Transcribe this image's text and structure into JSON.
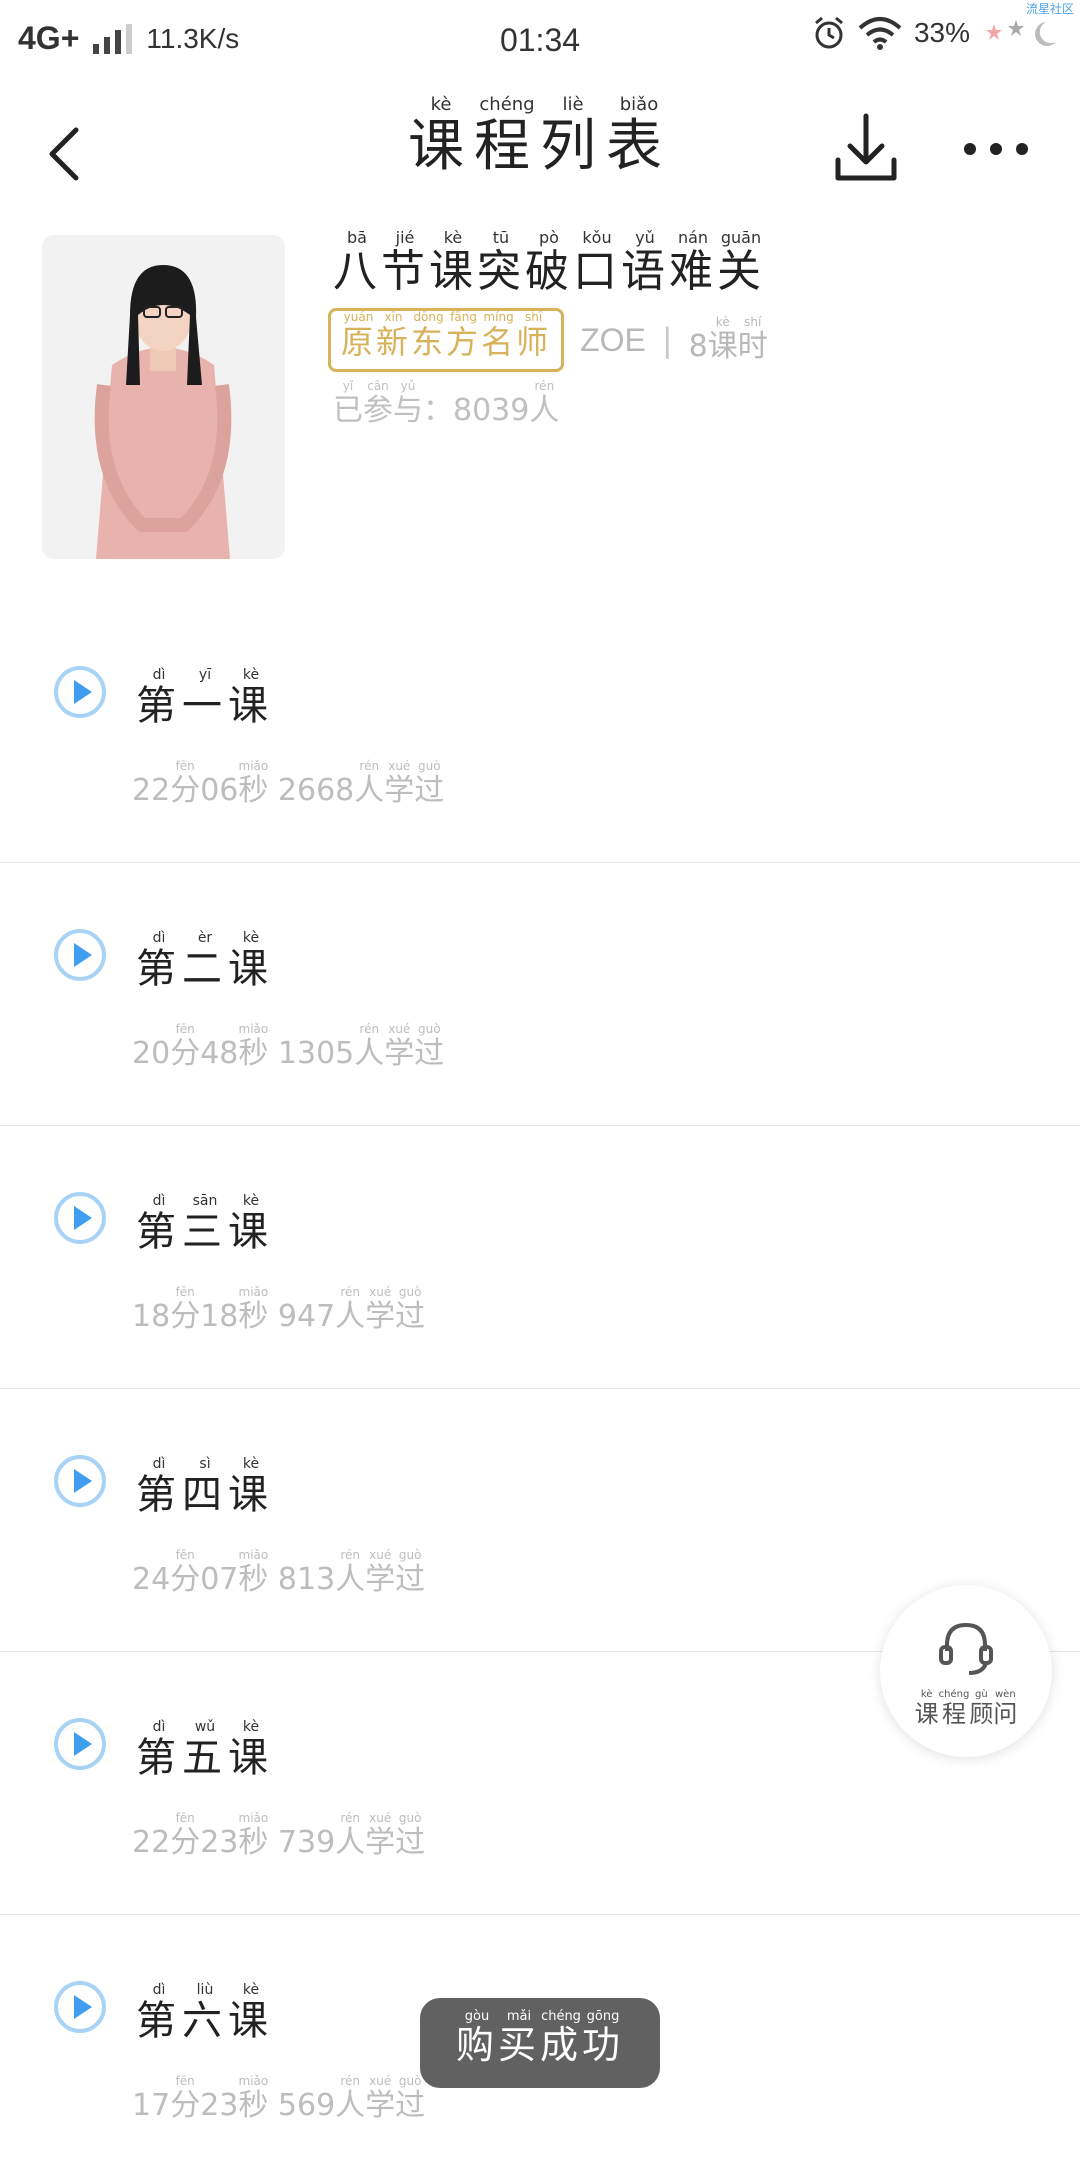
{
  "status_bar": {
    "network": "4G+",
    "speed": "11.3K/s",
    "time": "01:34",
    "battery": "33%",
    "brand_tag": "流星社区",
    "icons": [
      "signal-icon",
      "alarm-icon",
      "wifi-icon",
      "stars-moon-icon"
    ]
  },
  "nav": {
    "title": [
      {
        "c": "课",
        "p": "kè"
      },
      {
        "c": "程",
        "p": "chéng"
      },
      {
        "c": "列",
        "p": "liè"
      },
      {
        "c": "表",
        "p": "biǎo"
      }
    ],
    "icons": {
      "back": "back-chevron-icon",
      "download": "download-icon",
      "more": "more-dots-icon"
    }
  },
  "course": {
    "title": [
      {
        "c": "八",
        "p": "bā"
      },
      {
        "c": "节",
        "p": "jié"
      },
      {
        "c": "课",
        "p": "kè"
      },
      {
        "c": "突",
        "p": "tū"
      },
      {
        "c": "破",
        "p": "pò"
      },
      {
        "c": "口",
        "p": "kǒu"
      },
      {
        "c": "语",
        "p": "yǔ"
      },
      {
        "c": "难",
        "p": "nán"
      },
      {
        "c": "关",
        "p": "guān"
      }
    ],
    "teacher_badge": [
      {
        "c": "原",
        "p": "yuán"
      },
      {
        "c": "新",
        "p": "xīn"
      },
      {
        "c": "东",
        "p": "dōng"
      },
      {
        "c": "方",
        "p": "fāng"
      },
      {
        "c": "名",
        "p": "míng"
      },
      {
        "c": "师",
        "p": "shī"
      }
    ],
    "teacher_name": "ZOE",
    "separator": "|",
    "lesson_count": [
      {
        "c": "8",
        "p": ""
      },
      {
        "c": "课",
        "p": "kè"
      },
      {
        "c": "时",
        "p": "shí"
      }
    ],
    "participants": [
      {
        "c": "已",
        "p": "yǐ"
      },
      {
        "c": "参",
        "p": "cān"
      },
      {
        "c": "与",
        "p": "yǔ"
      },
      {
        "c": "：",
        "p": ""
      },
      {
        "c": "8039",
        "p": ""
      },
      {
        "c": "人",
        "p": "rén"
      }
    ]
  },
  "lessons": [
    {
      "title": [
        {
          "c": "第",
          "p": "dì"
        },
        {
          "c": "一",
          "p": "yī"
        },
        {
          "c": "课",
          "p": "kè"
        }
      ],
      "stats": [
        {
          "c": "22",
          "p": ""
        },
        {
          "c": "分",
          "p": "fēn"
        },
        {
          "c": "06",
          "p": ""
        },
        {
          "c": "秒",
          "p": "miǎo"
        },
        {
          "c": " 2668",
          "p": ""
        },
        {
          "c": "人",
          "p": "rén"
        },
        {
          "c": "学",
          "p": "xué"
        },
        {
          "c": "过",
          "p": "guò"
        }
      ]
    },
    {
      "title": [
        {
          "c": "第",
          "p": "dì"
        },
        {
          "c": "二",
          "p": "èr"
        },
        {
          "c": "课",
          "p": "kè"
        }
      ],
      "stats": [
        {
          "c": "20",
          "p": ""
        },
        {
          "c": "分",
          "p": "fēn"
        },
        {
          "c": "48",
          "p": ""
        },
        {
          "c": "秒",
          "p": "miǎo"
        },
        {
          "c": " 1305",
          "p": ""
        },
        {
          "c": "人",
          "p": "rén"
        },
        {
          "c": "学",
          "p": "xué"
        },
        {
          "c": "过",
          "p": "guò"
        }
      ]
    },
    {
      "title": [
        {
          "c": "第",
          "p": "dì"
        },
        {
          "c": "三",
          "p": "sān"
        },
        {
          "c": "课",
          "p": "kè"
        }
      ],
      "stats": [
        {
          "c": "18",
          "p": ""
        },
        {
          "c": "分",
          "p": "fēn"
        },
        {
          "c": "18",
          "p": ""
        },
        {
          "c": "秒",
          "p": "miǎo"
        },
        {
          "c": " 947",
          "p": ""
        },
        {
          "c": "人",
          "p": "rén"
        },
        {
          "c": "学",
          "p": "xué"
        },
        {
          "c": "过",
          "p": "guò"
        }
      ]
    },
    {
      "title": [
        {
          "c": "第",
          "p": "dì"
        },
        {
          "c": "四",
          "p": "sì"
        },
        {
          "c": "课",
          "p": "kè"
        }
      ],
      "stats": [
        {
          "c": "24",
          "p": ""
        },
        {
          "c": "分",
          "p": "fēn"
        },
        {
          "c": "07",
          "p": ""
        },
        {
          "c": "秒",
          "p": "miǎo"
        },
        {
          "c": " 813",
          "p": ""
        },
        {
          "c": "人",
          "p": "rén"
        },
        {
          "c": "学",
          "p": "xué"
        },
        {
          "c": "过",
          "p": "guò"
        }
      ]
    },
    {
      "title": [
        {
          "c": "第",
          "p": "dì"
        },
        {
          "c": "五",
          "p": "wǔ"
        },
        {
          "c": "课",
          "p": "kè"
        }
      ],
      "stats": [
        {
          "c": "22",
          "p": ""
        },
        {
          "c": "分",
          "p": "fēn"
        },
        {
          "c": "23",
          "p": ""
        },
        {
          "c": "秒",
          "p": "miǎo"
        },
        {
          "c": " 739",
          "p": ""
        },
        {
          "c": "人",
          "p": "rén"
        },
        {
          "c": "学",
          "p": "xué"
        },
        {
          "c": "过",
          "p": "guò"
        }
      ]
    },
    {
      "title": [
        {
          "c": "第",
          "p": "dì"
        },
        {
          "c": "六",
          "p": "liù"
        },
        {
          "c": "课",
          "p": "kè"
        }
      ],
      "stats": [
        {
          "c": "17",
          "p": ""
        },
        {
          "c": "分",
          "p": "fēn"
        },
        {
          "c": "23",
          "p": ""
        },
        {
          "c": "秒",
          "p": "miǎo"
        },
        {
          "c": " 569",
          "p": ""
        },
        {
          "c": "人",
          "p": "rén"
        },
        {
          "c": "学",
          "p": "xué"
        },
        {
          "c": "过",
          "p": "guò"
        }
      ]
    }
  ],
  "advisor": {
    "label": [
      {
        "c": "课",
        "p": "kè"
      },
      {
        "c": "程",
        "p": "chéng"
      },
      {
        "c": "顾",
        "p": "gù"
      },
      {
        "c": "问",
        "p": "wèn"
      }
    ],
    "icon": "headset-icon"
  },
  "toast": {
    "text": [
      {
        "c": "购",
        "p": "gòu"
      },
      {
        "c": "买",
        "p": "mǎi"
      },
      {
        "c": "成",
        "p": "chéng"
      },
      {
        "c": "功",
        "p": "gōng"
      }
    ]
  },
  "colors": {
    "accent_blue": "#4aa5f0",
    "badge_gold": "#d8b25a",
    "muted_text": "#bdbdbd",
    "divider": "#e5e5e5"
  }
}
